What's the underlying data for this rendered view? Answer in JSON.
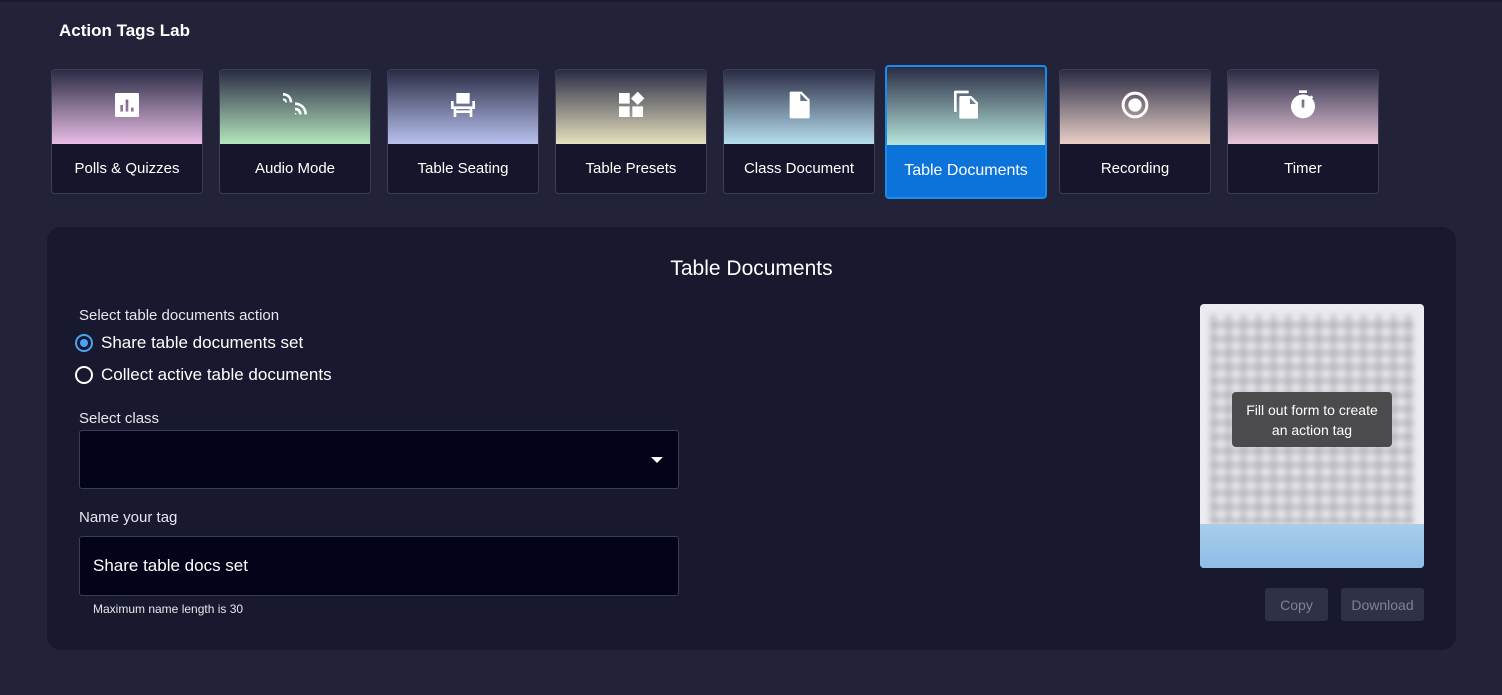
{
  "app": {
    "title": "Action Tags Lab"
  },
  "tiles": [
    {
      "label": "Polls & Quizzes",
      "icon": "bar-chart-icon",
      "tint": "#e8bde6"
    },
    {
      "label": "Audio Mode",
      "icon": "audio-waves-icon",
      "tint": "#b4e6bd"
    },
    {
      "label": "Table Seating",
      "icon": "chair-icon",
      "tint": "#b9c2ef"
    },
    {
      "label": "Table Presets",
      "icon": "widgets-icon",
      "tint": "#e6e1bf"
    },
    {
      "label": "Class Document",
      "icon": "document-icon",
      "tint": "#b7dfee"
    },
    {
      "label": "Table Documents",
      "icon": "documents-copy-icon",
      "tint": "#b6e6db",
      "active": true
    },
    {
      "label": "Recording",
      "icon": "record-icon",
      "tint": "#ead0c7"
    },
    {
      "label": "Timer",
      "icon": "stopwatch-icon",
      "tint": "#e8c6d8"
    }
  ],
  "panel": {
    "title": "Table Documents",
    "action_label": "Select table documents action",
    "options": [
      {
        "label": "Share table documents set",
        "checked": true
      },
      {
        "label": "Collect active table documents",
        "checked": false
      }
    ],
    "class_label": "Select class",
    "class_value": "",
    "name_label": "Name your tag",
    "name_value": "Share table docs set",
    "name_helper": "Maximum name length is 30",
    "qr_overlay": "Fill out form to create an action tag",
    "copy_label": "Copy",
    "download_label": "Download"
  },
  "colors": {
    "accent": "#0b73d9",
    "background": "#222339",
    "panel": "#18192f"
  }
}
